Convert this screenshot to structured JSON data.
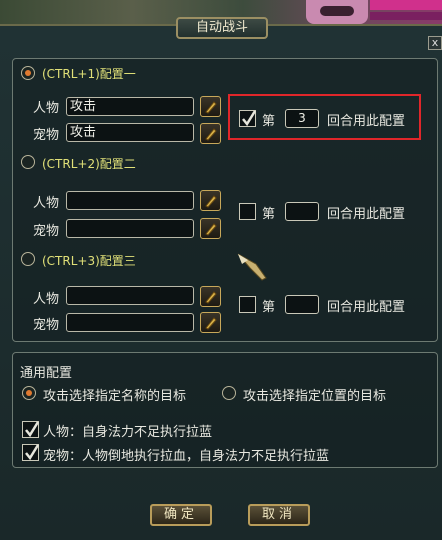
{
  "window": {
    "title": "自动战斗",
    "close_label": "x"
  },
  "configs": [
    {
      "label": "(CTRL+1)配置一",
      "selected": true,
      "person_label": "人物",
      "person_value": "攻击",
      "pet_label": "宠物",
      "pet_value": "攻击",
      "round_checked": true,
      "round_prefix": "第",
      "round_value": "3",
      "round_suffix": "回合用此配置"
    },
    {
      "label": "(CTRL+2)配置二",
      "selected": false,
      "person_label": "人物",
      "person_value": "",
      "pet_label": "宠物",
      "pet_value": "",
      "round_checked": false,
      "round_prefix": "第",
      "round_value": "",
      "round_suffix": "回合用此配置"
    },
    {
      "label": "(CTRL+3)配置三",
      "selected": false,
      "person_label": "人物",
      "person_value": "",
      "pet_label": "宠物",
      "pet_value": "",
      "round_checked": false,
      "round_prefix": "第",
      "round_value": "",
      "round_suffix": "回合用此配置"
    }
  ],
  "general": {
    "title": "通用配置",
    "target_by_name": {
      "label": "攻击选择指定名称的目标",
      "selected": true
    },
    "target_by_position": {
      "label": "攻击选择指定位置的目标",
      "selected": false
    },
    "person_mana": {
      "label": "人物：自身法力不足执行拉蓝",
      "checked": true
    },
    "pet_rules": {
      "label": "宠物：人物倒地执行拉血，自身法力不足执行拉蓝",
      "checked": true
    }
  },
  "buttons": {
    "ok": "确定",
    "cancel": "取消"
  },
  "colors": {
    "accent_radio": "#e07a30",
    "config_label": "#e0e078",
    "highlight_box": "#e0262a"
  }
}
